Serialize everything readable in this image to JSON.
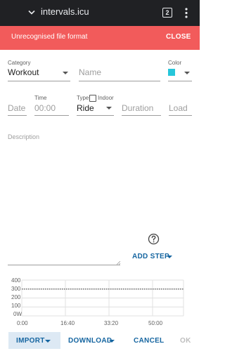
{
  "browser": {
    "url": "intervals.icu",
    "tab_count": "2"
  },
  "banner": {
    "message": "Unrecognised file format",
    "close_label": "CLOSE"
  },
  "form": {
    "category_label": "Category",
    "category_value": "Workout",
    "name_placeholder": "Name",
    "color_label": "Color",
    "color_value": "#26c6da",
    "date_placeholder": "Date",
    "time_label": "Time",
    "time_placeholder": "00:00",
    "type_label": "Type",
    "indoor_label": "Indoor",
    "type_value": "Ride",
    "duration_placeholder": "Duration",
    "load_placeholder": "Load",
    "description_placeholder": "Description"
  },
  "actions": {
    "add_step_label": "ADD STEP"
  },
  "chart_data": {
    "type": "line",
    "y_ticks": [
      "400",
      "300",
      "200",
      "100",
      "0W"
    ],
    "x_ticks": [
      "0:00",
      "16:40",
      "33:20",
      "50:00"
    ],
    "ylim": [
      0,
      400
    ],
    "reference_line": 300,
    "grid": true
  },
  "footer": {
    "import_label": "IMPORT",
    "download_label": "DOWNLOAD",
    "cancel_label": "CANCEL",
    "ok_label": "OK"
  }
}
